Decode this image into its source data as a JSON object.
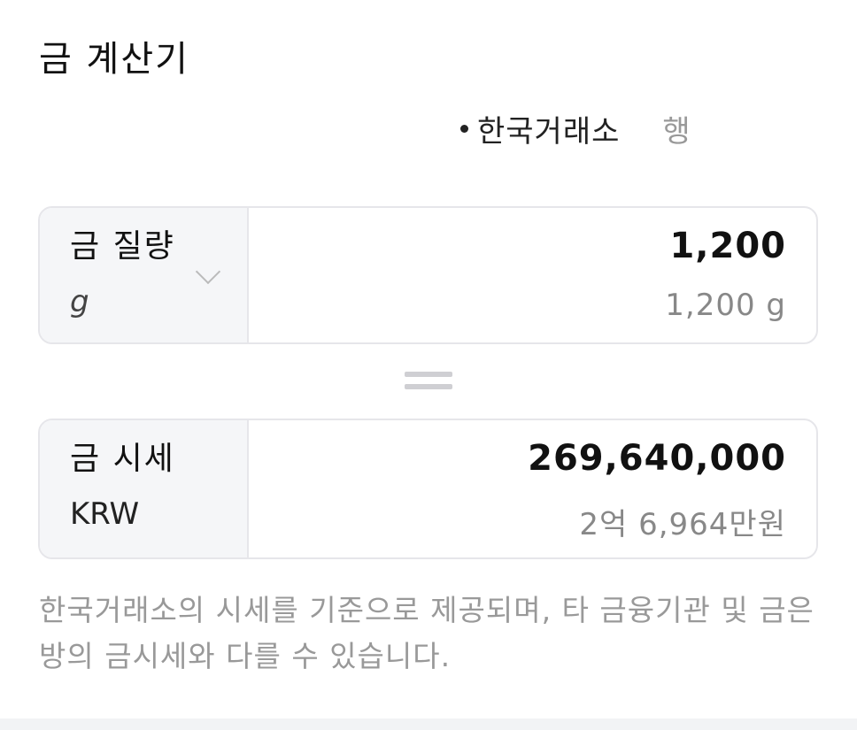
{
  "header": {
    "title": "금 계산기"
  },
  "source": {
    "label": "한국거래소",
    "suffix": "행"
  },
  "weight_card": {
    "unit_name": "금 질량",
    "unit_symbol": "g",
    "value": "1,200",
    "value_sub": "1,200 g"
  },
  "price_card": {
    "unit_name": "금 시세",
    "currency": "KRW",
    "value": "269,640,000",
    "value_sub": "2억 6,964만원"
  },
  "notice": {
    "text": "한국거래소의 시세를 기준으로 제공되며, 타 금융기관 및 금은방의 금시세와 다를 수 있습니다."
  },
  "colors": {
    "card_border": "#e6e6ea",
    "card_left_bg": "#f5f6f8",
    "muted_text": "#999999"
  }
}
